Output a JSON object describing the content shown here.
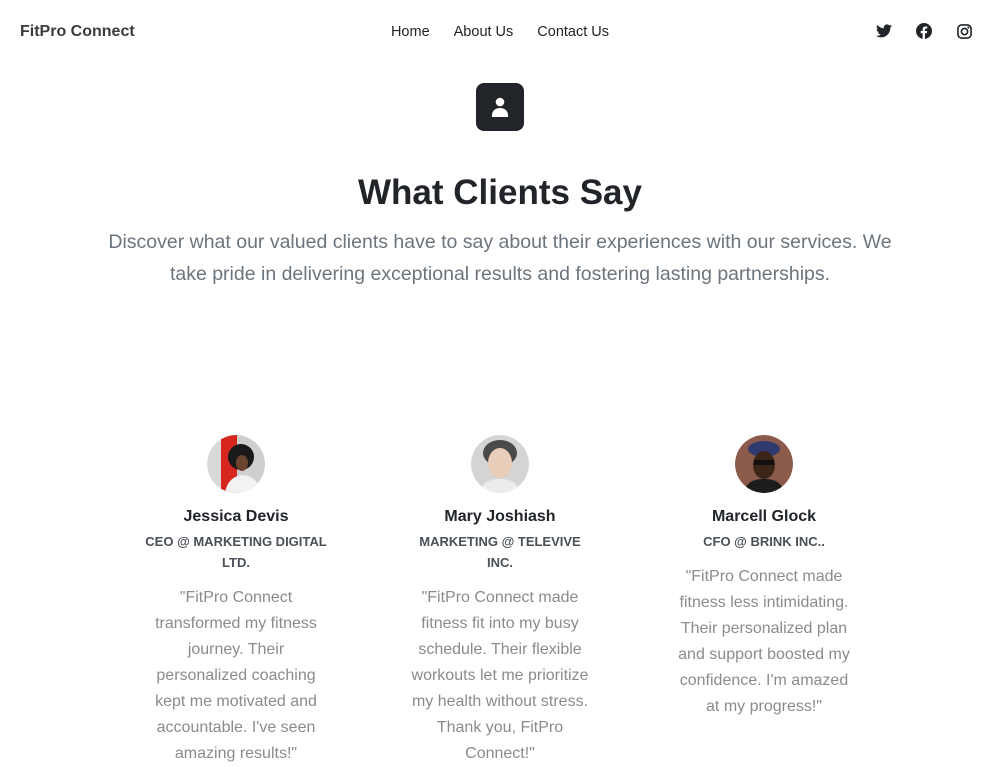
{
  "navbar": {
    "brand": "FitPro Connect",
    "links": [
      "Home",
      "About Us",
      "Contact Us"
    ],
    "social": [
      "twitter-icon",
      "facebook-icon",
      "instagram-icon"
    ]
  },
  "hero": {
    "icon": "person-icon",
    "title": "What Clients Say",
    "lead": "Discover what our valued clients have to say about their experiences with our services. We take pride in delivering exceptional results and fostering lasting partnerships."
  },
  "testimonials": [
    {
      "name": "Jessica Devis",
      "role": "CEO @ MARKETING DIGITAL LTD.",
      "quote": "\"FitPro Connect transformed my fitness journey. Their personalized coaching kept me motivated and accountable. I've seen amazing results!\""
    },
    {
      "name": "Mary Joshiash",
      "role": "MARKETING @ TELEVIVE INC.",
      "quote": "\"FitPro Connect made fitness fit into my busy schedule. Their flexible workouts let me prioritize my health without stress. Thank you, FitPro Connect!\""
    },
    {
      "name": "Marcell Glock",
      "role": "CFO @ BRINK INC..",
      "quote": "\"FitPro Connect made fitness less intimidating. Their personalized plan and support boosted my confidence. I'm amazed at my progress!\""
    }
  ],
  "colors": {
    "dark": "#212529",
    "muted": "#6c757d",
    "quote": "#8b8b8b"
  }
}
